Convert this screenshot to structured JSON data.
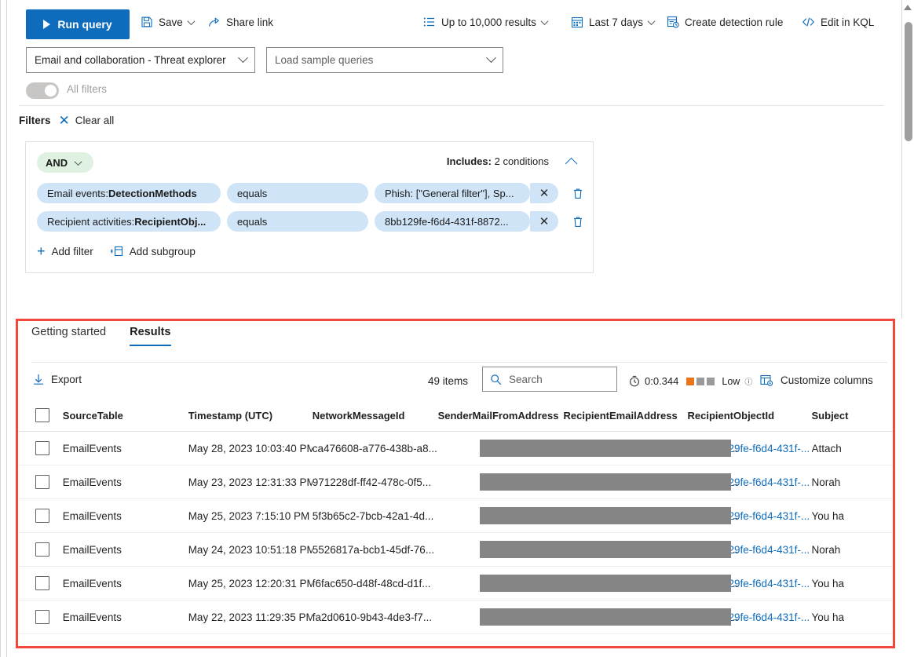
{
  "toolbar": {
    "run_query": "Run query",
    "save": "Save",
    "share_link": "Share link",
    "results_limit": "Up to 10,000 results",
    "time_range": "Last 7 days",
    "create_detection_rule": "Create detection rule",
    "edit_in_kql": "Edit in KQL",
    "icons": {
      "run": "play-icon",
      "save": "save-icon",
      "share": "share-icon",
      "results_limit": "list-icon",
      "time_range": "calendar-icon",
      "detection_rule": "rule-icon",
      "kql": "code-icon"
    }
  },
  "selectors": {
    "scenario": "Email and collaboration - Threat explorer",
    "sample_queries_placeholder": "Load sample queries"
  },
  "all_filters": {
    "label": "All filters",
    "enabled": false
  },
  "filters": {
    "title": "Filters",
    "clear_all": "Clear all",
    "group": {
      "operator": "AND",
      "includes_label": "Includes:",
      "includes_value": "2 conditions",
      "conditions": [
        {
          "field_prefix": "Email events: ",
          "field": "DetectionMethods",
          "operator": "equals",
          "value": "Phish: [\"General filter\"], Sp..."
        },
        {
          "field_prefix": "Recipient activities: ",
          "field": "RecipientObj...",
          "operator": "equals",
          "value": "8bb129fe-f6d4-431f-8872..."
        }
      ],
      "add_filter": "Add filter",
      "add_subgroup": "Add subgroup"
    }
  },
  "results": {
    "tabs": [
      {
        "label": "Getting started",
        "active": false
      },
      {
        "label": "Results",
        "active": true
      }
    ],
    "export": "Export",
    "items_count": "49 items",
    "search_placeholder": "Search",
    "perf_time": "0:0.344",
    "perf_level": "Low",
    "customize_columns": "Customize columns",
    "accent_color": "#0f6cbd",
    "perf_bar_color": "#e8741c",
    "perf_bar_empty_color": "#9a9a9a",
    "highlight_color": "#f2483c",
    "columns": [
      "SourceTable",
      "Timestamp (UTC)",
      "NetworkMessageId",
      "SenderMailFromAddress",
      "RecipientEmailAddress",
      "RecipientObjectId",
      "Subject"
    ],
    "rows": [
      {
        "source_table": "EmailEvents",
        "timestamp": "May 28, 2023 10:03:40 PM",
        "network_message_id": "ca476608-a776-438b-a8...",
        "sender_mail_from_address": "",
        "recipient_email_address": "..",
        "recipient_object_id": "8bb129fe-f6d4-431f-...",
        "subject": "Attach"
      },
      {
        "source_table": "EmailEvents",
        "timestamp": "May 23, 2023 12:31:33 PM",
        "network_message_id": "971228df-ff42-478c-0f5...",
        "sender_mail_from_address": "",
        "recipient_email_address": "..",
        "recipient_object_id": "8bb129fe-f6d4-431f-...",
        "subject": "Norah"
      },
      {
        "source_table": "EmailEvents",
        "timestamp": "May 25, 2023 7:15:10 PM",
        "network_message_id": "5f3b65c2-7bcb-42a1-4d...",
        "sender_mail_from_address": "",
        "recipient_email_address": "..",
        "recipient_object_id": "8bb129fe-f6d4-431f-...",
        "subject": "You ha"
      },
      {
        "source_table": "EmailEvents",
        "timestamp": "May 24, 2023 10:51:18 PM",
        "network_message_id": "5526817a-bcb1-45df-76...",
        "sender_mail_from_address": "",
        "recipient_email_address": "..",
        "recipient_object_id": "8bb129fe-f6d4-431f-...",
        "subject": "Norah"
      },
      {
        "source_table": "EmailEvents",
        "timestamp": "May 25, 2023 12:20:31 PM",
        "network_message_id": "f6fac650-d48f-48cd-d1f...",
        "sender_mail_from_address": "",
        "recipient_email_address": "..",
        "recipient_object_id": "8bb129fe-f6d4-431f-...",
        "subject": "You ha"
      },
      {
        "source_table": "EmailEvents",
        "timestamp": "May 22, 2023 11:29:35 PM",
        "network_message_id": "fa2d0610-9b43-4de3-f7...",
        "sender_mail_from_address": "",
        "recipient_email_address": "..",
        "recipient_object_id": "8bb129fe-f6d4-431f-...",
        "subject": "You ha"
      }
    ]
  }
}
